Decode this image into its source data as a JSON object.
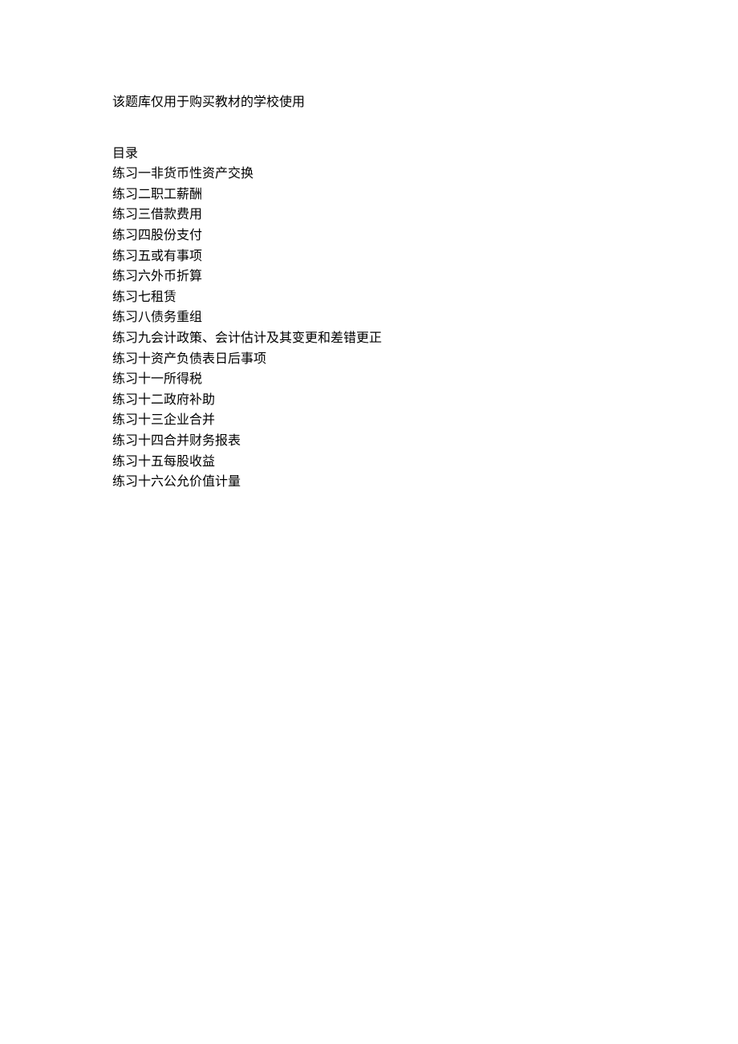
{
  "notice": "该题库仅用于购买教材的学校使用",
  "toc_header": "目录",
  "toc_items": [
    "练习一非货币性资产交换",
    "练习二职工薪酬",
    "练习三借款费用",
    "练习四股份支付",
    "练习五或有事项",
    "练习六外币折算",
    "练习七租赁",
    "练习八债务重组",
    "练习九会计政策、会计估计及其变更和差错更正",
    "练习十资产负债表日后事项",
    "练习十一所得税",
    "练习十二政府补助",
    "练习十三企业合并",
    "练习十四合并财务报表",
    "练习十五每股收益",
    "练习十六公允价值计量"
  ]
}
